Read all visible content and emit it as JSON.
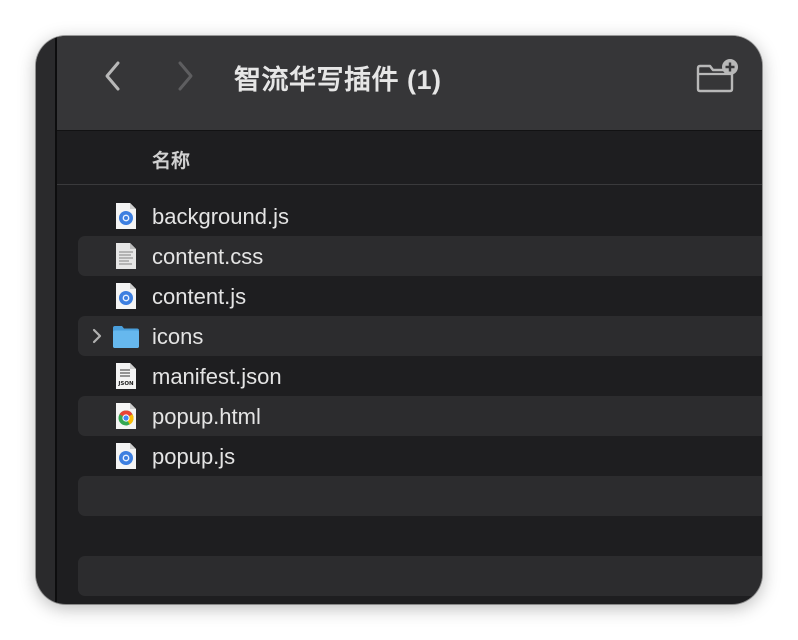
{
  "window": {
    "title": "智流华写插件 (1)"
  },
  "toolbar": {
    "back_icon": "chevron-left-icon",
    "forward_icon": "chevron-right-icon",
    "new_folder_icon": "new-folder-icon"
  },
  "columns": {
    "name_header": "名称"
  },
  "files": [
    {
      "name": "background.js",
      "icon": "js-file-icon",
      "type": "file"
    },
    {
      "name": "content.css",
      "icon": "css-file-icon",
      "type": "file"
    },
    {
      "name": "content.js",
      "icon": "js-file-icon",
      "type": "file"
    },
    {
      "name": "icons",
      "icon": "folder-icon",
      "type": "folder"
    },
    {
      "name": "manifest.json",
      "icon": "json-file-icon",
      "type": "file",
      "icon_label": "JSON"
    },
    {
      "name": "popup.html",
      "icon": "html-file-icon",
      "type": "file"
    },
    {
      "name": "popup.js",
      "icon": "js-file-icon",
      "type": "file"
    }
  ],
  "colors": {
    "window_bg": "#1e1e20",
    "toolbar_bg": "#363638",
    "alt_row_bg": "#2c2c2e",
    "text": "#e4e4e4",
    "folder_blue": "#5fb4ea"
  }
}
